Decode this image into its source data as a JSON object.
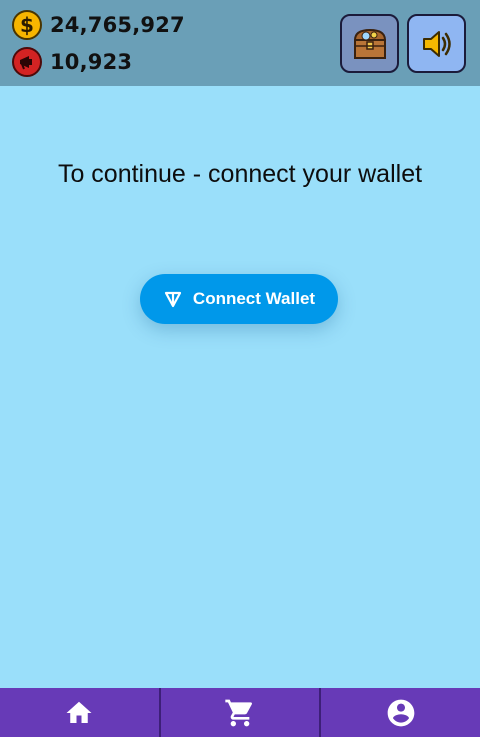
{
  "header": {
    "coins": {
      "value": "24,765,927",
      "icon": "dollar-coin-icon",
      "symbol": "$"
    },
    "tickets": {
      "value": "10,923",
      "icon": "megaphone-icon"
    },
    "buttons": [
      {
        "name": "treasure-chest-button",
        "icon": "treasure-chest-icon"
      },
      {
        "name": "sound-toggle-button",
        "icon": "speaker-icon"
      }
    ]
  },
  "main": {
    "message": "To continue - connect your wallet",
    "connect_button": {
      "label": "Connect Wallet",
      "icon": "ton-icon"
    }
  },
  "bottom_nav": {
    "items": [
      {
        "name": "home",
        "icon": "home-icon"
      },
      {
        "name": "shop",
        "icon": "cart-icon"
      },
      {
        "name": "profile",
        "icon": "account-icon"
      }
    ]
  },
  "colors": {
    "background": "#9adffa",
    "header": "#6a9fb7",
    "button_blue": "#0098ea",
    "nav": "#673ab7",
    "coin": "#f7b500",
    "ticket": "#d32323"
  }
}
